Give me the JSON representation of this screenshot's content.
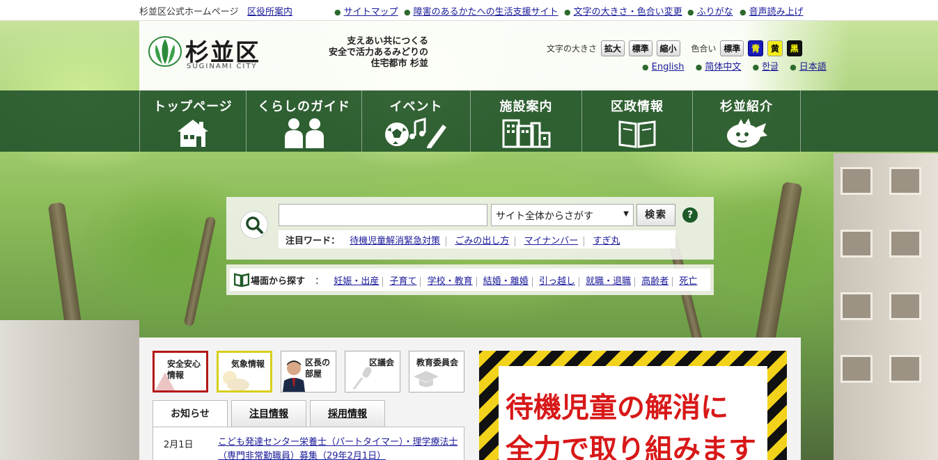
{
  "topbar": {
    "site_label": "杉並区公式ホームページ",
    "office_guide": "区役所案内",
    "sitemap": "サイトマップ",
    "disability_site": "障害のあるかたへの生活支援サイト",
    "text_size_color": "文字の大きさ・色合い変更",
    "furigana": "ふりがな",
    "read_aloud": "音声読み上げ"
  },
  "brand": {
    "name": "杉並区",
    "name_en": "SUGINAMI CITY",
    "slogan_line1": "支えあい共につくる",
    "slogan_line2": "安全で活力あるみどりの",
    "slogan_line3": "住宅都市 杉並"
  },
  "settings": {
    "text_size_label": "文字の大きさ",
    "enlarge": "拡大",
    "standard": "標準",
    "shrink": "縮小",
    "color_label": "色合い",
    "color_standard": "標準",
    "color_blue": "青",
    "color_yellow": "黄",
    "color_black": "黒"
  },
  "languages": [
    "English",
    "简体中文",
    "한글",
    "日本語"
  ],
  "gnav": [
    {
      "label": "トップページ",
      "icon": "house-icon"
    },
    {
      "label": "くらしのガイド",
      "icon": "people-icon"
    },
    {
      "label": "イベント",
      "icon": "soccer-ball-icon"
    },
    {
      "label": "施設案内",
      "icon": "buildings-icon"
    },
    {
      "label": "区政情報",
      "icon": "book-icon"
    },
    {
      "label": "杉並紹介",
      "icon": "mascot-icon"
    }
  ],
  "search": {
    "input_value": "",
    "scope": "サイト全体からさがす",
    "button": "検索",
    "help": "?",
    "hot_label": "注目ワード：",
    "hot_words": [
      "待機児童解消緊急対策",
      "ごみの出し方",
      "マイナンバー",
      "すぎ丸"
    ]
  },
  "scenes": {
    "label": "場面から探す",
    "colon": "：",
    "items": [
      "妊娠・出産",
      "子育て",
      "学校・教育",
      "結婚・離婚",
      "引っ越し",
      "就職・退職",
      "高齢者",
      "死亡"
    ]
  },
  "quick": [
    {
      "line1": "安全安心",
      "line2": "情報"
    },
    {
      "line1": "気象情報",
      "line2": ""
    },
    {
      "line1": "区長の",
      "line2": "部屋"
    },
    {
      "line1": "区議会",
      "line2": ""
    },
    {
      "line1": "教育委員会",
      "line2": ""
    }
  ],
  "tabs": [
    "お知らせ",
    "注目情報",
    "採用情報"
  ],
  "news": [
    {
      "date": "2月1日",
      "text": "こども発達センター栄養士（パートタイマー）・理学療法士（専門非常勤職員）募集（29年2月1日）"
    }
  ],
  "banner": {
    "line1": "待機児童の解消に",
    "line2": "全力で取り組みます"
  }
}
